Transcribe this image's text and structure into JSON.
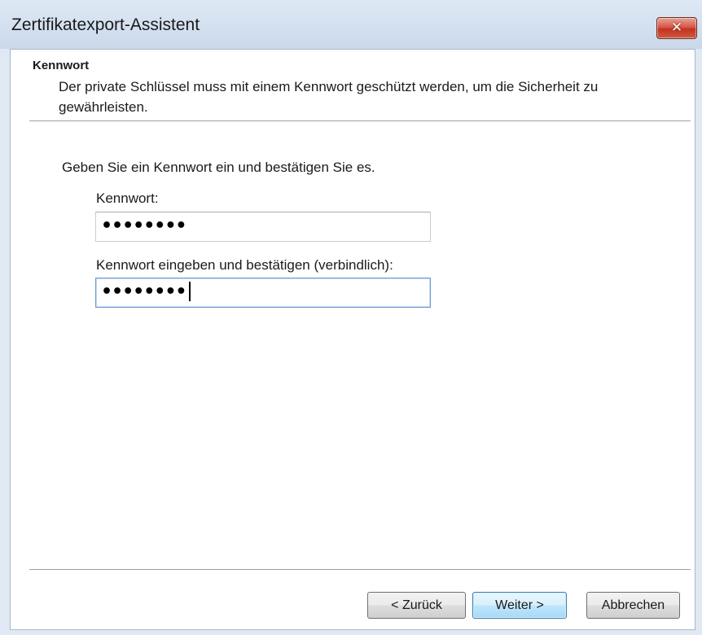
{
  "window": {
    "title": "Zertifikatexport-Assistent",
    "close_glyph": "✕"
  },
  "header": {
    "title": "Kennwort",
    "description": "Der private Schlüssel muss mit einem Kennwort geschützt werden, um die Sicherheit zu gewährleisten."
  },
  "form": {
    "instruction": "Geben Sie ein Kennwort ein und bestätigen Sie es.",
    "password_label": "Kennwort:",
    "password_value_masked": "••••••••",
    "confirm_label": "Kennwort eingeben und bestätigen (verbindlich):",
    "confirm_value_masked": "••••••••"
  },
  "buttons": {
    "back": "< Zurück",
    "next": "Weiter >",
    "cancel": "Abbrechen"
  },
  "colors": {
    "title_bar": "#d4e1f0",
    "close_button": "#c3331f",
    "focus_border": "#6a9bd0",
    "default_button_border": "#3c7fb1"
  }
}
